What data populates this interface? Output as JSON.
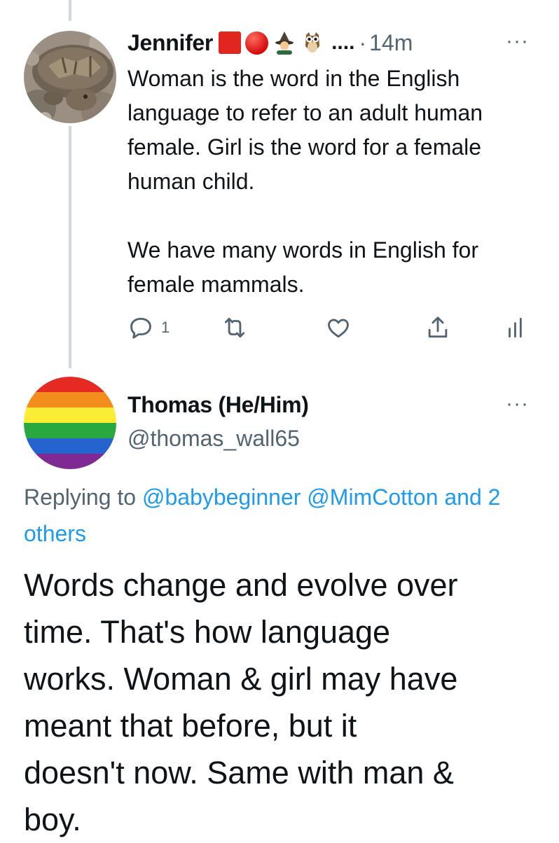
{
  "parent_tweet": {
    "display_name": "Jennifer",
    "name_emojis": [
      "red-square",
      "red-circle",
      "mage",
      "owl"
    ],
    "name_truncation": "....",
    "time_separator": "·",
    "timestamp": "14m",
    "more_label": "···",
    "text_paragraphs": [
      "Woman is the word in the English language to refer to an adult human female.  Girl is the word for a female human child.",
      "We have many words in English for female mammals."
    ],
    "actions": {
      "reply_count": "1"
    }
  },
  "reply_tweet": {
    "display_name": "Thomas (He/Him)",
    "handle": "@thomas_wall65",
    "more_label": "···",
    "replying_prefix": "Replying to",
    "mention_1": "@babybeginner",
    "mention_2": "@MimCotton",
    "mention_others": "and 2 others",
    "text_lines": [
      "Words change and evolve over",
      "time. That's how language",
      "works. Woman & girl may have",
      "meant that before, but it",
      "doesn't now. Same with man &",
      "boy."
    ]
  },
  "colors": {
    "text": "#0f1419",
    "secondary": "#536471",
    "link": "#1d9bf0",
    "thread_line": "#cfd9de",
    "rainbow": [
      "#e52a24",
      "#f28d1e",
      "#fbec35",
      "#28a83e",
      "#2563cf",
      "#7e2a92"
    ]
  }
}
